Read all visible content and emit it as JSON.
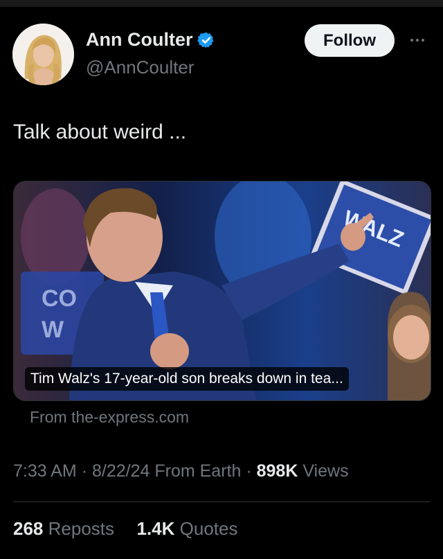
{
  "author": {
    "name": "Ann Coulter",
    "handle": "@AnnCoulter",
    "verified": true
  },
  "follow_label": "Follow",
  "tweet_text": "Talk about weird ...",
  "card": {
    "caption": "Tim Walz's 17-year-old son breaks down in tea...",
    "source": "From the-express.com"
  },
  "meta": {
    "time": "7:33 AM",
    "date": "8/22/24",
    "from": "From Earth",
    "views_count": "898K",
    "views_label": "Views"
  },
  "stats": {
    "reposts_count": "268",
    "reposts_label": "Reposts",
    "quotes_count": "1.4K",
    "quotes_label": "Quotes"
  },
  "colors": {
    "background": "#000000",
    "verified_badge": "#1d9bf0",
    "muted_text": "#71767b",
    "follow_bg": "#eff3f4"
  }
}
